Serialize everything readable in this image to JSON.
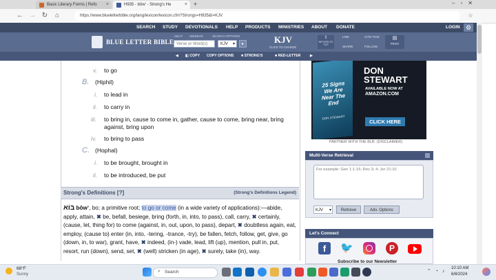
{
  "browser": {
    "tabs": [
      {
        "title": "Basic Literary Forms | Refo"
      },
      {
        "title": "H935 - bôw' - Strong's He"
      }
    ],
    "url": "https://www.blueletterbible.org/lang/lexicon/lexicon.cfm?Strongs=H935&t=KJV"
  },
  "nav": {
    "items": [
      "SEARCH",
      "STUDY",
      "DEVOTIONALS",
      "HELP",
      "PRODUCTS",
      "MINISTRIES",
      "ABOUT",
      "DONATE"
    ],
    "login": "LOGIN"
  },
  "header": {
    "logo": "BLUE LETTER BIBLE",
    "help_label": "HELP",
    "sidebar_label": "SIDEBAR",
    "options_label": "SEARCH OPTIONS",
    "search_placeholder": "Verse or Word(s)",
    "version": "KJV",
    "version_big": "KJV",
    "version_sub": "CLICK TO CHANGE",
    "return_top": "RETURN TO TOP",
    "link": "LINK",
    "cite": "CITE THIS",
    "share": "SHARE",
    "follow": "FOLLOW",
    "print": "PRINT"
  },
  "toolbar": {
    "copy": "COPY",
    "copy_options": "COPY OPTIONS",
    "strongs": "STRONG'S",
    "red_letter": "RED-LETTER"
  },
  "outline": {
    "v": {
      "num": "v.",
      "text": "to go"
    },
    "B": {
      "num": "B.",
      "text": "(Hiphil)"
    },
    "B_items": [
      {
        "num": "i.",
        "text": "to lead in"
      },
      {
        "num": "ii.",
        "text": "to carry in"
      },
      {
        "num": "iii.",
        "text": "to bring in, cause to come in, gather, cause to come, bring near, bring against, bring upon"
      },
      {
        "num": "iv.",
        "text": "to bring to pass"
      }
    ],
    "C": {
      "num": "C.",
      "text": "(Hophal)"
    },
    "C_items": [
      {
        "num": "i.",
        "text": "to be brought, brought in"
      },
      {
        "num": "ii.",
        "text": "to be introduced, be put"
      }
    ]
  },
  "definitions": {
    "heading": "Strong's Definitions [?]",
    "legend": "(Strong's Definitions Legend)",
    "hebrew": "בּוֹא",
    "translit": "bôwʼ",
    "lead": ", bo; a primitive root; ",
    "highlight": "to go or come",
    "rest1": " (in a wide variety of applications):—abide, apply, attain, ",
    "rest2": " be, befall, besiege, bring (forth, in, into, to pass), call, carry, ",
    "rest3": " certainly, (cause, let, thing for) to come (against, in, out, upon, to pass), depart, ",
    "rest4": " doubtless again, eat, employ, (cause to) enter (in, into, -tering, -trance, -try), be fallen, fetch, follow, get, give, go (down, in, to war), grant, have, ",
    "rest5": " indeed, (in-) vade, lead, lift (up), mention, pull in, put, resort, run (down), send, set, ",
    "rest6": " (well) stricken (in age), ",
    "rest7": " surely, take (in), way.",
    "mark": "✖"
  },
  "ad": {
    "top": "DON STEWART",
    "available": "AVAILABLE NOW AT",
    "amazon": "AMAZON.COM",
    "book_title": "25 Signs We Are Near The End",
    "book_author": "DON STEWART",
    "cta": "CLICK HERE",
    "partner": "PARTNER WITH THE BLB",
    "disclaimer": "(DISCLAIMER)"
  },
  "multiverse": {
    "title": "Multi-Verse Retrieval",
    "placeholder": "For example: Gen 1:1-15; Rev 3; 4; Jer 21:10",
    "version": "KJV",
    "retrieve": "Retrieve",
    "adv": "Adv. Options"
  },
  "connect": {
    "title": "Let's Connect",
    "subscribe": "Subscribe to our Newsletter"
  },
  "taskbar": {
    "temp": "68°F",
    "weather": "Sunny",
    "search": "Search",
    "time": "10:10 AM",
    "date": "6/8/2024"
  },
  "colors": {
    "nav": "#3d4b66",
    "header": "#5a6c8f",
    "panel": "#45557a",
    "highlight": "#3c5a9a"
  }
}
